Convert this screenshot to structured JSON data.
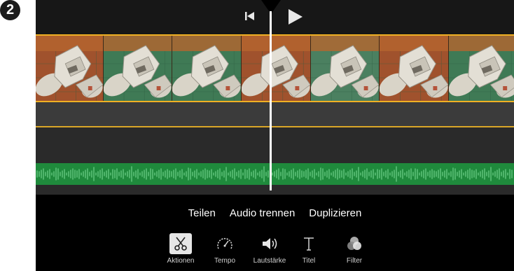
{
  "step_badge": "2",
  "colors": {
    "accent_yellow": "#f0b023",
    "audio_green": "#1f8a3c",
    "toolbar_bg": "#171717",
    "track_gray": "#3b3b3b"
  },
  "player": {
    "skip_back_icon": "skip-to-start-icon",
    "play_icon": "play-icon"
  },
  "actions_menu": [
    "Teilen",
    "Audio trennen",
    "Duplizieren"
  ],
  "tool_tabs": [
    {
      "label": "Aktionen",
      "icon": "scissors-icon",
      "selected": true
    },
    {
      "label": "Tempo",
      "icon": "speedometer-icon",
      "selected": false
    },
    {
      "label": "Lautstärke",
      "icon": "speaker-icon",
      "selected": false
    },
    {
      "label": "Titel",
      "icon": "text-icon",
      "selected": false
    },
    {
      "label": "Filter",
      "icon": "filter-circles-icon",
      "selected": false
    }
  ]
}
